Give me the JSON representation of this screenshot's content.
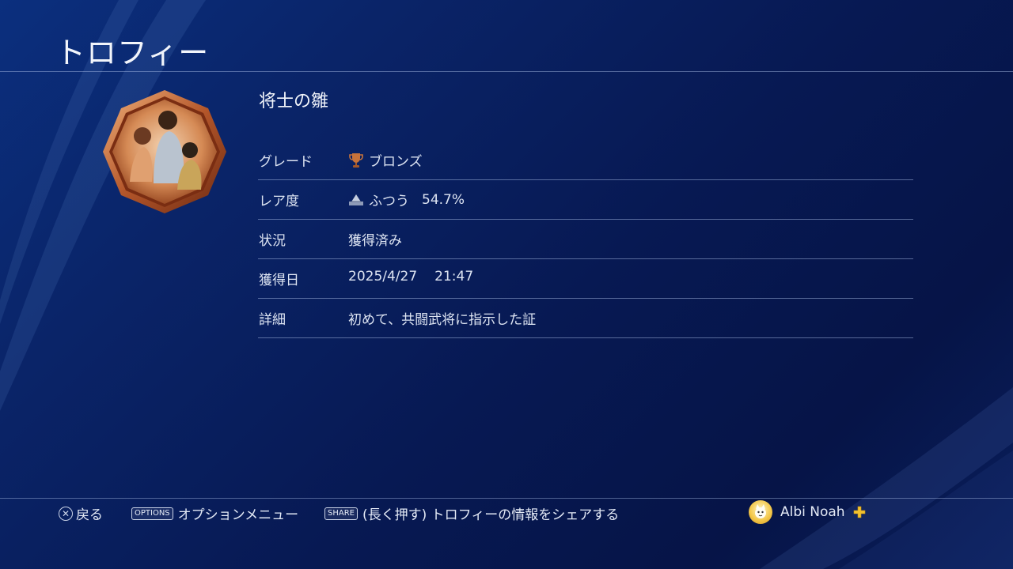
{
  "header": {
    "title": "トロフィー"
  },
  "trophy": {
    "name": "将士の雛",
    "rows": [
      {
        "label": "グレード",
        "value": "ブロンズ",
        "icon": "bronze-trophy-icon"
      },
      {
        "label": "レア度",
        "value": "ふつう",
        "extra": "54.7%",
        "icon": "rarity-pyramid-icon"
      },
      {
        "label": "状況",
        "value": "獲得済み"
      },
      {
        "label": "獲得日",
        "value": "2025/4/27",
        "extra": "21:47"
      },
      {
        "label": "詳細",
        "value": "初めて、共闘武将に指示した証"
      }
    ]
  },
  "footer": {
    "back_label": "戻る",
    "options_key": "OPTIONS",
    "options_label": "オプションメニュー",
    "share_key": "SHARE",
    "share_label": "(長く押す) トロフィーの情報をシェアする",
    "user_name": "Albi Noah"
  },
  "colors": {
    "bronze": "#c8733a",
    "plus": "#f2c12e",
    "background": "#071953"
  }
}
